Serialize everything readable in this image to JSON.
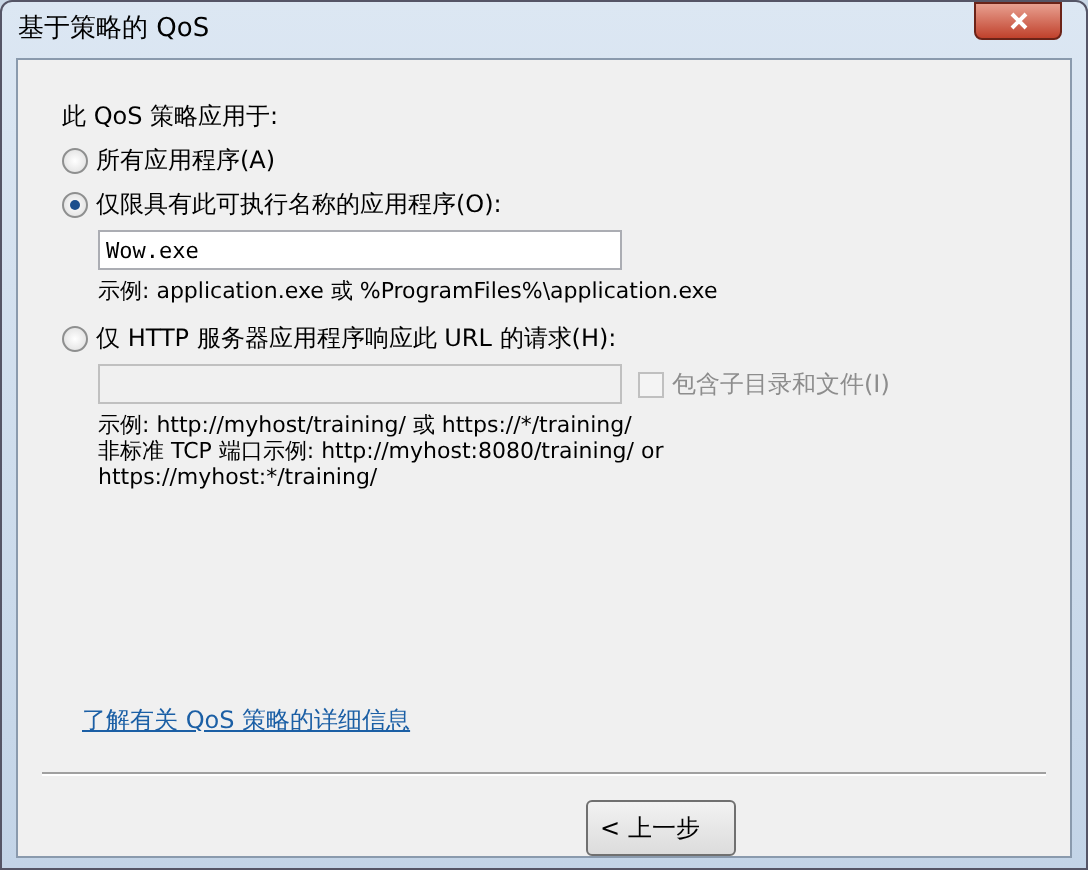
{
  "window": {
    "title": "基于策略的 QoS"
  },
  "heading": "此 QoS 策略应用于:",
  "options": [
    {
      "label": "所有应用程序(A)",
      "selected": false
    },
    {
      "label": "仅限具有此可执行名称的应用程序(O):",
      "selected": true,
      "field": {
        "value": "Wow.exe",
        "disabled": false
      },
      "examples": [
        "示例:  application.exe 或 %ProgramFiles%\\application.exe"
      ]
    },
    {
      "label": "仅 HTTP 服务器应用程序响应此 URL 的请求(H):",
      "selected": false,
      "field": {
        "disabled": true
      },
      "checkbox": {
        "label": "包含子目录和文件(I)",
        "checked": false,
        "disabled": true
      },
      "examples": [
        "示例:  http://myhost/training/ 或 https://*/training/",
        "非标准 TCP 端口示例:  http://myhost:8080/training/ or",
        "https://myhost:*/training/"
      ]
    }
  ],
  "link": "了解有关 QoS 策略的详细信息",
  "buttons": [
    "< 上一步"
  ]
}
